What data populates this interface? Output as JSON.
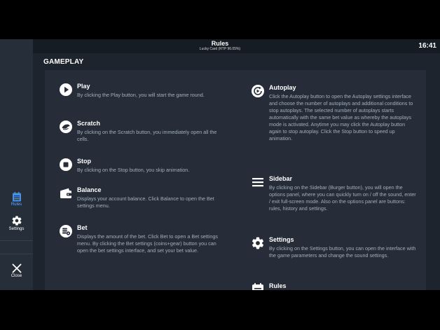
{
  "header": {
    "title": "Rules",
    "subtitle": "Lucky Card (RTP 96.05%)",
    "clock": "16:41"
  },
  "sidebar": {
    "rules_label": "Rules",
    "settings_label": "Settings",
    "close_label": "Close"
  },
  "section": {
    "title": "GAMEPLAY"
  },
  "items": {
    "play": {
      "title": "Play",
      "desc": "By clicking the Play button, you will start the game round."
    },
    "scratch": {
      "title": "Scratch",
      "desc": "By clicking on the Scratch button, you immediately open all the cells."
    },
    "stop": {
      "title": "Stop",
      "desc": "By clicking on the Stop button, you skip animation."
    },
    "balance": {
      "title": "Balance",
      "desc": "Displays your account balance. Click Balance to open the Bet settings menu."
    },
    "bet": {
      "title": "Bet",
      "desc": "Displays the amount of the bet. Click Bet to open a Bet settings menu. By clicking the Bet settings (coins+gear) button you can open the bet settings interface, and set your bet value."
    },
    "autoplay": {
      "title": "Autoplay",
      "desc": "Click the Autoplay button to open the Autoplay settings interface and choose the number of autoplays and additional conditions to stop autoplays. The selected number of autoplays starts automatically with the same bet value as whereby the autoplays mode is activated. Anytime you may click the Autoplay button again to stop autoplay. Click the Stop button to speed up animation."
    },
    "sidebar": {
      "title": "Sidebar",
      "desc": "By clicking on the Sidebar (Burger button), you will open the options panel, where you can quickly turn on / off the sound, enter / exit full-screen mode. Also on the options panel are buttons: rules, history and settings."
    },
    "settings": {
      "title": "Settings",
      "desc": "By clicking on the Settings button, you can open the interface with the game parameters and change the sound settings."
    },
    "rules": {
      "title": "Rules"
    }
  },
  "colors": {
    "background": "#1b222b",
    "panel": "#262d38",
    "sidebar": "#262e39",
    "text_muted": "#a3aebb",
    "accent": "#3d7fd9"
  }
}
